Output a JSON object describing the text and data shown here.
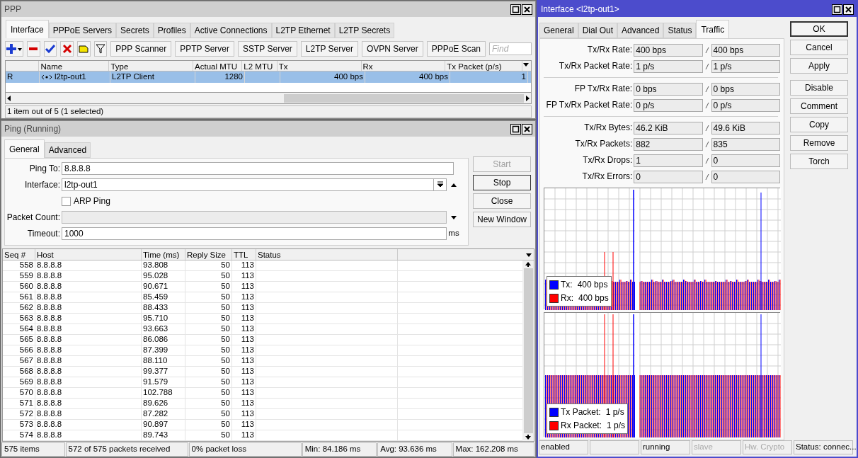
{
  "ppp_window": {
    "title": "PPP",
    "tabs": [
      {
        "label": "Interface",
        "selected": true
      },
      {
        "label": "PPPoE Servers",
        "selected": false
      },
      {
        "label": "Secrets",
        "selected": false
      },
      {
        "label": "Profiles",
        "selected": false
      },
      {
        "label": "Active Connections",
        "selected": false
      },
      {
        "label": "L2TP Ethernet",
        "selected": false
      },
      {
        "label": "L2TP Secrets",
        "selected": false
      }
    ],
    "toolbar_buttons": [
      "PPP Scanner",
      "PPTP Server",
      "SSTP Server",
      "L2TP Server",
      "OVPN Server",
      "PPPoE Scan"
    ],
    "find": {
      "placeholder": "Find"
    },
    "table": {
      "columns": [
        "Name",
        "Type",
        "Actual MTU",
        "L2 MTU",
        "Tx",
        "Rx",
        "Tx Packet (p/s)"
      ],
      "rows": [
        {
          "flag": "R",
          "name": "l2tp-out1",
          "type": "L2TP Client",
          "actual_mtu": "1280",
          "tx": "400 bps",
          "rx": "400 bps",
          "tx_packet": "1",
          "selected": true
        }
      ]
    },
    "status": "1 item out of 5 (1 selected)"
  },
  "ping_window": {
    "title": "Ping (Running)",
    "tabs": [
      {
        "label": "General",
        "selected": true
      },
      {
        "label": "Advanced",
        "selected": false
      }
    ],
    "fields": [
      {
        "kind": "text",
        "label": "Ping To:",
        "value": "8.8.8.8"
      },
      {
        "kind": "select",
        "label": "Interface:",
        "value": "l2tp-out1"
      },
      {
        "kind": "checkbox",
        "label": "ARP Ping",
        "checked": false
      },
      {
        "kind": "disabled",
        "label": "Packet Count:"
      },
      {
        "kind": "unit",
        "label": "Timeout:",
        "value": "1000",
        "unit": "ms"
      }
    ],
    "buttons": [
      {
        "label": "Start",
        "disabled": true,
        "default": false
      },
      {
        "label": "Stop",
        "disabled": false,
        "default": true
      },
      {
        "label": "Close",
        "disabled": false,
        "default": false
      },
      {
        "label": "New Window",
        "disabled": false,
        "default": false
      }
    ],
    "table": {
      "columns": [
        "Seq #",
        "Host",
        "Time (ms)",
        "Reply Size",
        "TTL",
        "Status"
      ],
      "rows": [
        [
          "558",
          "8.8.8.8",
          "93.808",
          "50",
          "113"
        ],
        [
          "559",
          "8.8.8.8",
          "95.028",
          "50",
          "113"
        ],
        [
          "560",
          "8.8.8.8",
          "90.671",
          "50",
          "113"
        ],
        [
          "561",
          "8.8.8.8",
          "85.459",
          "50",
          "113"
        ],
        [
          "562",
          "8.8.8.8",
          "88.433",
          "50",
          "113"
        ],
        [
          "563",
          "8.8.8.8",
          "95.710",
          "50",
          "113"
        ],
        [
          "564",
          "8.8.8.8",
          "93.663",
          "50",
          "113"
        ],
        [
          "565",
          "8.8.8.8",
          "86.086",
          "50",
          "113"
        ],
        [
          "566",
          "8.8.8.8",
          "87.399",
          "50",
          "113"
        ],
        [
          "567",
          "8.8.8.8",
          "88.110",
          "50",
          "113"
        ],
        [
          "568",
          "8.8.8.8",
          "99.377",
          "50",
          "113"
        ],
        [
          "569",
          "8.8.8.8",
          "91.579",
          "50",
          "113"
        ],
        [
          "570",
          "8.8.8.8",
          "102.788",
          "50",
          "113"
        ],
        [
          "571",
          "8.8.8.8",
          "89.626",
          "50",
          "113"
        ],
        [
          "572",
          "8.8.8.8",
          "87.282",
          "50",
          "113"
        ],
        [
          "573",
          "8.8.8.8",
          "90.897",
          "50",
          "113"
        ],
        [
          "574",
          "8.8.8.8",
          "89.743",
          "50",
          "113"
        ]
      ]
    },
    "status_bar": [
      "575 items",
      "572 of 575 packets received",
      "0% packet loss",
      "Min: 84.186 ms",
      "Avg: 93.636 ms",
      "Max: 162.208 ms"
    ]
  },
  "interface_window": {
    "title": "Interface <l2tp-out1>",
    "tabs": [
      {
        "label": "General",
        "selected": false
      },
      {
        "label": "Dial Out",
        "selected": false
      },
      {
        "label": "Advanced",
        "selected": false
      },
      {
        "label": "Status",
        "selected": false
      },
      {
        "label": "Traffic",
        "selected": true
      }
    ],
    "groups": [
      [
        {
          "label": "Tx/Rx Rate:",
          "tx": "400 bps",
          "rx": "400 bps"
        },
        {
          "label": "Tx/Rx Packet Rate:",
          "tx": "1 p/s",
          "rx": "1 p/s"
        }
      ],
      [
        {
          "label": "FP Tx/Rx Rate:",
          "tx": "0 bps",
          "rx": "0 bps"
        },
        {
          "label": "FP Tx/Rx Packet Rate:",
          "tx": "0 p/s",
          "rx": "0 p/s"
        }
      ],
      [
        {
          "label": "Tx/Rx Bytes:",
          "tx": "46.2 KiB",
          "rx": "49.6 KiB"
        },
        {
          "label": "Tx/Rx Packets:",
          "tx": "882",
          "rx": "835"
        },
        {
          "label": "Tx/Rx Drops:",
          "tx": "1",
          "rx": "0"
        },
        {
          "label": "Tx/Rx Errors:",
          "tx": "0",
          "rx": "0"
        }
      ]
    ],
    "graphs": [
      {
        "legend": [
          {
            "label": "Tx:",
            "value": "400 bps",
            "color": "#0000ff"
          },
          {
            "label": "Rx:",
            "value": "400 bps",
            "color": "#ff0000"
          }
        ]
      },
      {
        "legend": [
          {
            "label": "Tx Packet:",
            "value": "1 p/s",
            "color": "#0000ff"
          },
          {
            "label": "Rx Packet:",
            "value": "1 p/s",
            "color": "#ff0000"
          }
        ]
      }
    ],
    "buttons": [
      {
        "label": "OK",
        "default": true
      },
      {
        "label": "Cancel",
        "default": false
      },
      {
        "label": "Apply",
        "default": false
      },
      {
        "label": "Disable",
        "default": false
      },
      {
        "label": "Comment",
        "default": false
      },
      {
        "label": "Copy",
        "default": false
      },
      {
        "label": "Remove",
        "default": false
      },
      {
        "label": "Torch",
        "default": false
      }
    ],
    "status_bar": [
      {
        "text": "enabled",
        "disabled": false
      },
      {
        "text": "running",
        "disabled": false
      },
      {
        "text": "slave",
        "disabled": true
      },
      {
        "text": "Hw. Crypto",
        "disabled": true
      },
      {
        "text": "Status: connec...",
        "disabled": false
      }
    ]
  }
}
